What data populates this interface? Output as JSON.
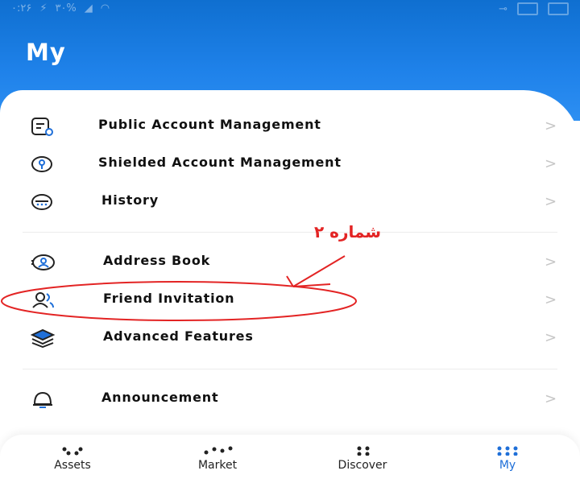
{
  "status_bar": {
    "time": "۰:۲۶",
    "battery": "۳۰%"
  },
  "header": {
    "title": "My"
  },
  "menu": {
    "items": [
      {
        "label": "Public Account Management",
        "icon": "document-icon"
      },
      {
        "label": "Shielded Account Management",
        "icon": "shield-key-icon"
      },
      {
        "label": "History",
        "icon": "history-icon"
      },
      {
        "label": "Address Book",
        "icon": "address-book-icon"
      },
      {
        "label": "Friend Invitation",
        "icon": "users-icon"
      },
      {
        "label": "Advanced Features",
        "icon": "layers-icon"
      },
      {
        "label": "Announcement",
        "icon": "bell-icon"
      }
    ],
    "chevron": ">"
  },
  "annotation": {
    "text": "شماره ۲",
    "color": "#e32424"
  },
  "bottom_nav": {
    "tabs": [
      {
        "label": "Assets",
        "active": false
      },
      {
        "label": "Market",
        "active": false
      },
      {
        "label": "Discover",
        "active": false
      },
      {
        "label": "My",
        "active": true
      }
    ]
  },
  "colors": {
    "accent": "#1f6fd8",
    "header": "#1f82ea",
    "annotation": "#e32424"
  }
}
